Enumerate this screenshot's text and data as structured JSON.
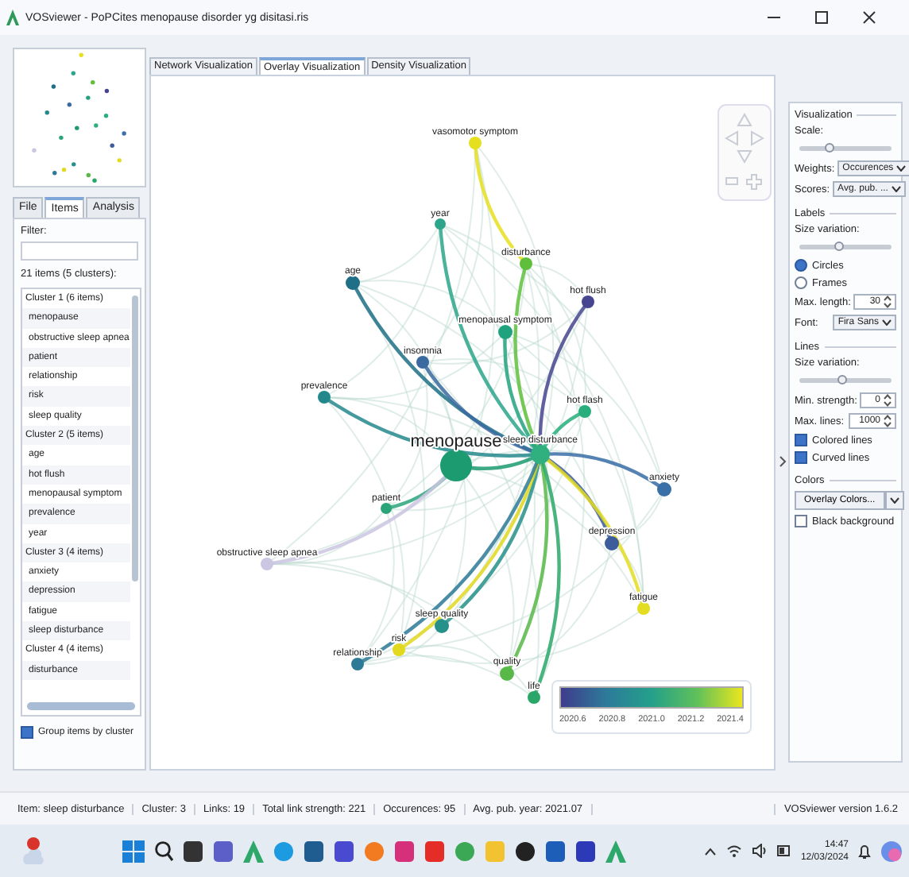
{
  "window": {
    "title": "VOSviewer - PoPCites menopause disorder yg disitasi.ris"
  },
  "view_tabs": [
    {
      "label": "Network Visualization",
      "selected": false
    },
    {
      "label": "Overlay Visualization",
      "selected": true
    },
    {
      "label": "Density Visualization",
      "selected": false
    }
  ],
  "panel_tabs": [
    {
      "label": "File",
      "selected": false
    },
    {
      "label": "Items",
      "selected": true
    },
    {
      "label": "Analysis",
      "selected": false
    }
  ],
  "filter": {
    "label": "Filter:"
  },
  "items_count": "21 items (5 clusters):",
  "item_list": [
    {
      "kind": "cluster",
      "label": "Cluster 1 (6 items)"
    },
    {
      "kind": "item",
      "label": "menopause"
    },
    {
      "kind": "item",
      "label": "obstructive sleep apnea"
    },
    {
      "kind": "item",
      "label": "patient"
    },
    {
      "kind": "item",
      "label": "relationship"
    },
    {
      "kind": "item",
      "label": "risk"
    },
    {
      "kind": "item",
      "label": "sleep quality"
    },
    {
      "kind": "cluster",
      "label": "Cluster 2 (5 items)"
    },
    {
      "kind": "item",
      "label": "age"
    },
    {
      "kind": "item",
      "label": "hot flush"
    },
    {
      "kind": "item",
      "label": "menopausal symptom"
    },
    {
      "kind": "item",
      "label": "prevalence"
    },
    {
      "kind": "item",
      "label": "year"
    },
    {
      "kind": "cluster",
      "label": "Cluster 3 (4 items)"
    },
    {
      "kind": "item",
      "label": "anxiety"
    },
    {
      "kind": "item",
      "label": "depression"
    },
    {
      "kind": "item",
      "label": "fatigue"
    },
    {
      "kind": "item",
      "label": "sleep disturbance"
    },
    {
      "kind": "cluster",
      "label": "Cluster 4 (4 items)"
    },
    {
      "kind": "item",
      "label": "disturbance"
    }
  ],
  "group_by_cluster": {
    "label": "Group items by cluster",
    "checked": true
  },
  "map": {
    "nodes": [
      {
        "label": "vasomotor symptom",
        "color": "#e6df1f"
      },
      {
        "label": "year",
        "color": "#2ca58a"
      },
      {
        "label": "disturbance",
        "color": "#5fbf3c"
      },
      {
        "label": "age",
        "color": "#1f6f86"
      },
      {
        "label": "hot flush",
        "color": "#47458f"
      },
      {
        "label": "menopausal symptom",
        "color": "#21a27e"
      },
      {
        "label": "insomnia",
        "color": "#3b6aa1"
      },
      {
        "label": "prevalence",
        "color": "#23888c"
      },
      {
        "label": "hot flash",
        "color": "#27ae7c"
      },
      {
        "label": "menopause",
        "color": "#1c9a70"
      },
      {
        "label": "sleep disturbance",
        "color": "#2fb07e"
      },
      {
        "label": "anxiety",
        "color": "#3a6fa8"
      },
      {
        "label": "patient",
        "color": "#2aa57a"
      },
      {
        "label": "depression",
        "color": "#3d5c9c"
      },
      {
        "label": "obstructive sleep apnea",
        "color": "#cbc6e2"
      },
      {
        "label": "fatigue",
        "color": "#e3dd22"
      },
      {
        "label": "sleep quality",
        "color": "#26908a"
      },
      {
        "label": "risk",
        "color": "#e2d81e"
      },
      {
        "label": "relationship",
        "color": "#2e7a96"
      },
      {
        "label": "quality",
        "color": "#58b848"
      },
      {
        "label": "life",
        "color": "#2aa768"
      }
    ],
    "legend": {
      "ticks": [
        "2020.6",
        "2020.8",
        "2021.0",
        "2021.2",
        "2021.4"
      ]
    }
  },
  "settings": [
    {
      "title": "Visualization",
      "controls": [
        {
          "kind": "slider",
          "label": "Scale:",
          "level": 0.33
        },
        {
          "kind": "select",
          "label": "Weights:",
          "value": "Occurences"
        },
        {
          "kind": "select",
          "label": "Scores:",
          "value": "Avg. pub. ..."
        }
      ]
    },
    {
      "title": "Labels",
      "controls": [
        {
          "kind": "slider",
          "label": "Size variation:",
          "level": 0.43
        },
        {
          "kind": "radio",
          "label": "Circles",
          "selected": true
        },
        {
          "kind": "radio",
          "label": "Frames",
          "selected": false
        },
        {
          "kind": "spinner",
          "label": "Max. length:",
          "value": "30"
        },
        {
          "kind": "select",
          "label": "Font:",
          "value": "Fira Sans"
        }
      ]
    },
    {
      "title": "Lines",
      "controls": [
        {
          "kind": "slider",
          "label": "Size variation:",
          "level": 0.47
        },
        {
          "kind": "spinner",
          "label": "Min. strength:",
          "value": "0"
        },
        {
          "kind": "spinner",
          "label": "Max. lines:",
          "value": "1000"
        },
        {
          "kind": "checkbox",
          "label": "Colored lines",
          "checked": true
        },
        {
          "kind": "checkbox",
          "label": "Curved lines",
          "checked": true
        }
      ]
    },
    {
      "title": "Colors",
      "controls": [
        {
          "kind": "splitbutton",
          "label": "Overlay Colors..."
        },
        {
          "kind": "checkbox",
          "label": "Black background",
          "checked": false
        }
      ]
    }
  ],
  "status_bar": {
    "fields": [
      "Item: sleep disturbance",
      "Cluster: 3",
      "Links: 19",
      "Total link strength: 221",
      "Occurences: 95",
      "Avg. pub. year: 2021.07"
    ],
    "version": "VOSviewer version 1.6.2"
  },
  "taskbar": {
    "time": "14:47",
    "date": "12/03/2024"
  }
}
